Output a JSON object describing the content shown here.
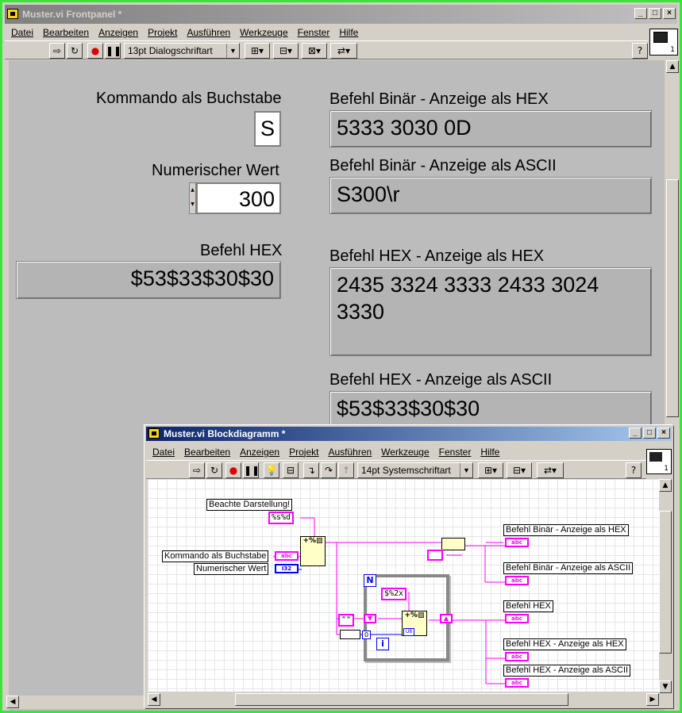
{
  "front": {
    "title": "Muster.vi Frontpanel *",
    "menu": [
      "Datei",
      "Bearbeiten",
      "Anzeigen",
      "Projekt",
      "Ausführen",
      "Werkzeuge",
      "Fenster",
      "Hilfe"
    ],
    "font_selector": "13pt Dialogschriftart",
    "help_icon": "?",
    "vi_icon_number": "1",
    "controls": {
      "kommando_label": "Kommando als Buchstabe",
      "kommando_value": "S",
      "numerisch_label": "Numerischer Wert",
      "numerisch_value": "300",
      "befehl_hex_label": "Befehl HEX",
      "befehl_hex_value": "$53$33$30$30"
    },
    "indicators": {
      "bin_hex_label": "Befehl Binär - Anzeige als HEX",
      "bin_hex_value": "5333 3030 0D",
      "bin_ascii_label": "Befehl Binär - Anzeige als ASCII",
      "bin_ascii_value": "S300\\r",
      "hex_hex_label": "Befehl HEX - Anzeige als HEX",
      "hex_hex_value": "2435 3324 3333 2433 3024\n3330",
      "hex_ascii_label": "Befehl HEX - Anzeige als ASCII",
      "hex_ascii_value": "$53$33$30$30"
    }
  },
  "block": {
    "title": "Muster.vi Blockdiagramm *",
    "menu": [
      "Datei",
      "Bearbeiten",
      "Anzeigen",
      "Projekt",
      "Ausführen",
      "Werkzeuge",
      "Fenster",
      "Hilfe"
    ],
    "font_selector": "14pt Systemschriftart",
    "help_icon": "?",
    "vi_icon_number": "1",
    "labels": {
      "comment": "Beachte Darstellung!",
      "format_const": "%s%d",
      "kommando": "Kommando als Buchstabe",
      "numerisch": "Numerischer Wert",
      "num_type": "I32",
      "str_type": "abc",
      "hex_format": "$%2x",
      "empty_string": "\"\"",
      "loop_n": "N",
      "loop_i": "i",
      "out_bin_hex": "Befehl Binär - Anzeige als HEX",
      "out_bin_ascii": "Befehl Binär - Anzeige als ASCII",
      "out_hex": "Befehl HEX",
      "out_hex_hex": "Befehl HEX - Anzeige als HEX",
      "out_hex_ascii": "Befehl HEX - Anzeige als ASCII",
      "zero": "0",
      "u8_type": "U8"
    }
  },
  "colors": {
    "string_wire": "#ff00ff",
    "numeric_wire": "#0000ff",
    "frame_green": "#3ee23e",
    "titlebar_active": "#0a246a"
  }
}
